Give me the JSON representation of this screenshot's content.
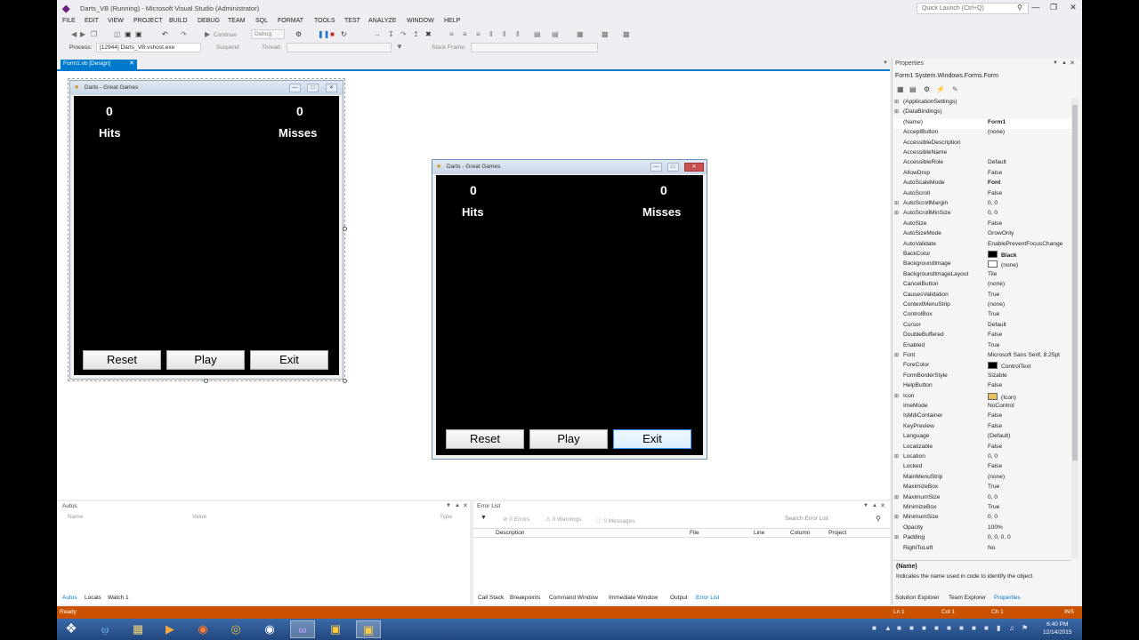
{
  "window": {
    "title": "Darts_VB (Running) - Microsoft Visual Studio (Administrator)",
    "quick_launch_placeholder": "Quick Launch (Ctrl+Q)"
  },
  "menu": [
    "FILE",
    "EDIT",
    "VIEW",
    "PROJECT",
    "BUILD",
    "DEBUG",
    "TEAM",
    "SQL",
    "FORMAT",
    "TOOLS",
    "TEST",
    "ANALYZE",
    "WINDOW",
    "HELP"
  ],
  "toolbar": {
    "continue_label": "Continue",
    "config_value": "Debug",
    "process_label": "Process:",
    "process_value": "[12944] Darts_VB.vshost.exe",
    "suspend_label": "Suspend",
    "thread_label": "Thread:",
    "stack_frame_label": "Stack Frame:"
  },
  "document_tab": {
    "label": "Form1.vb [Design]"
  },
  "game": {
    "window_title": "Darts - Great Games",
    "hits_value": "0",
    "misses_value": "0",
    "hits_label": "Hits",
    "misses_label": "Misses",
    "reset_label": "Reset",
    "play_label": "Play",
    "exit_label": "Exit"
  },
  "properties": {
    "title": "Properties",
    "object": "Form1  System.Windows.Forms.Form",
    "rows": [
      {
        "name": "(ApplicationSettings)",
        "value": "",
        "expand": true
      },
      {
        "name": "(DataBindings)",
        "value": "",
        "expand": true
      },
      {
        "name": "(Name)",
        "value": "Form1",
        "bold": true
      },
      {
        "name": "AcceptButton",
        "value": "(none)"
      },
      {
        "name": "AccessibleDescription",
        "value": ""
      },
      {
        "name": "AccessibleName",
        "value": ""
      },
      {
        "name": "AccessibleRole",
        "value": "Default"
      },
      {
        "name": "AllowDrop",
        "value": "False"
      },
      {
        "name": "AutoScaleMode",
        "value": "Font",
        "bold": true
      },
      {
        "name": "AutoScroll",
        "value": "False"
      },
      {
        "name": "AutoScrollMargin",
        "value": "0, 0",
        "expand": true
      },
      {
        "name": "AutoScrollMinSize",
        "value": "0, 0",
        "expand": true
      },
      {
        "name": "AutoSize",
        "value": "False"
      },
      {
        "name": "AutoSizeMode",
        "value": "GrowOnly"
      },
      {
        "name": "AutoValidate",
        "value": "EnablePreventFocusChange"
      },
      {
        "name": "BackColor",
        "value": "Black",
        "bold": true,
        "swatch": "#000000"
      },
      {
        "name": "BackgroundImage",
        "value": "(none)",
        "swatch": "#ffffff"
      },
      {
        "name": "BackgroundImageLayout",
        "value": "Tile"
      },
      {
        "name": "CancelButton",
        "value": "(none)"
      },
      {
        "name": "CausesValidation",
        "value": "True"
      },
      {
        "name": "ContextMenuStrip",
        "value": "(none)"
      },
      {
        "name": "ControlBox",
        "value": "True"
      },
      {
        "name": "Cursor",
        "value": "Default"
      },
      {
        "name": "DoubleBuffered",
        "value": "False"
      },
      {
        "name": "Enabled",
        "value": "True"
      },
      {
        "name": "Font",
        "value": "Microsoft Sans Serif, 8.25pt",
        "expand": true
      },
      {
        "name": "ForeColor",
        "value": "ControlText",
        "swatch": "#000000"
      },
      {
        "name": "FormBorderStyle",
        "value": "Sizable"
      },
      {
        "name": "HelpButton",
        "value": "False"
      },
      {
        "name": "Icon",
        "value": "(Icon)",
        "expand": true,
        "swatch": "#e8c060"
      },
      {
        "name": "ImeMode",
        "value": "NoControl"
      },
      {
        "name": "IsMdiContainer",
        "value": "False"
      },
      {
        "name": "KeyPreview",
        "value": "False"
      },
      {
        "name": "Language",
        "value": "(Default)"
      },
      {
        "name": "Localizable",
        "value": "False"
      },
      {
        "name": "Location",
        "value": "0, 0",
        "expand": true
      },
      {
        "name": "Locked",
        "value": "False"
      },
      {
        "name": "MainMenuStrip",
        "value": "(none)"
      },
      {
        "name": "MaximizeBox",
        "value": "True"
      },
      {
        "name": "MaximumSize",
        "value": "0, 0",
        "expand": true
      },
      {
        "name": "MinimizeBox",
        "value": "True"
      },
      {
        "name": "MinimumSize",
        "value": "0, 0",
        "expand": true
      },
      {
        "name": "Opacity",
        "value": "100%"
      },
      {
        "name": "Padding",
        "value": "0, 0, 0, 0",
        "expand": true
      },
      {
        "name": "RightToLeft",
        "value": "No"
      }
    ],
    "desc_title": "(Name)",
    "desc_text": "Indicates the name used in code to identify the object."
  },
  "right_tabs": [
    "Solution Explorer",
    "Team Explorer",
    "Properties"
  ],
  "autos": {
    "title": "Autos",
    "columns": [
      "Name",
      "Value",
      "Type"
    ],
    "tabs": [
      "Autos",
      "Locals",
      "Watch 1"
    ]
  },
  "error_list": {
    "title": "Error List",
    "errors": "0 Errors",
    "warnings": "0 Warnings",
    "messages": "0 Messages",
    "search_placeholder": "Search Error List",
    "columns": [
      "Description",
      "File",
      "Line",
      "Column",
      "Project"
    ],
    "tabs": [
      "Call Stack",
      "Breakpoints",
      "Command Window",
      "Immediate Window",
      "Output",
      "Error List"
    ]
  },
  "status": {
    "text": "Ready",
    "ln": "Ln 1",
    "col": "Col 1",
    "ch": "Ch 1",
    "ins": "INS"
  },
  "taskbar": {
    "time": "6:40 PM",
    "date": "12/14/2015"
  },
  "colors": {
    "accent": "#007acc",
    "status_bar": "#ca5100",
    "game_background": "#000000"
  }
}
